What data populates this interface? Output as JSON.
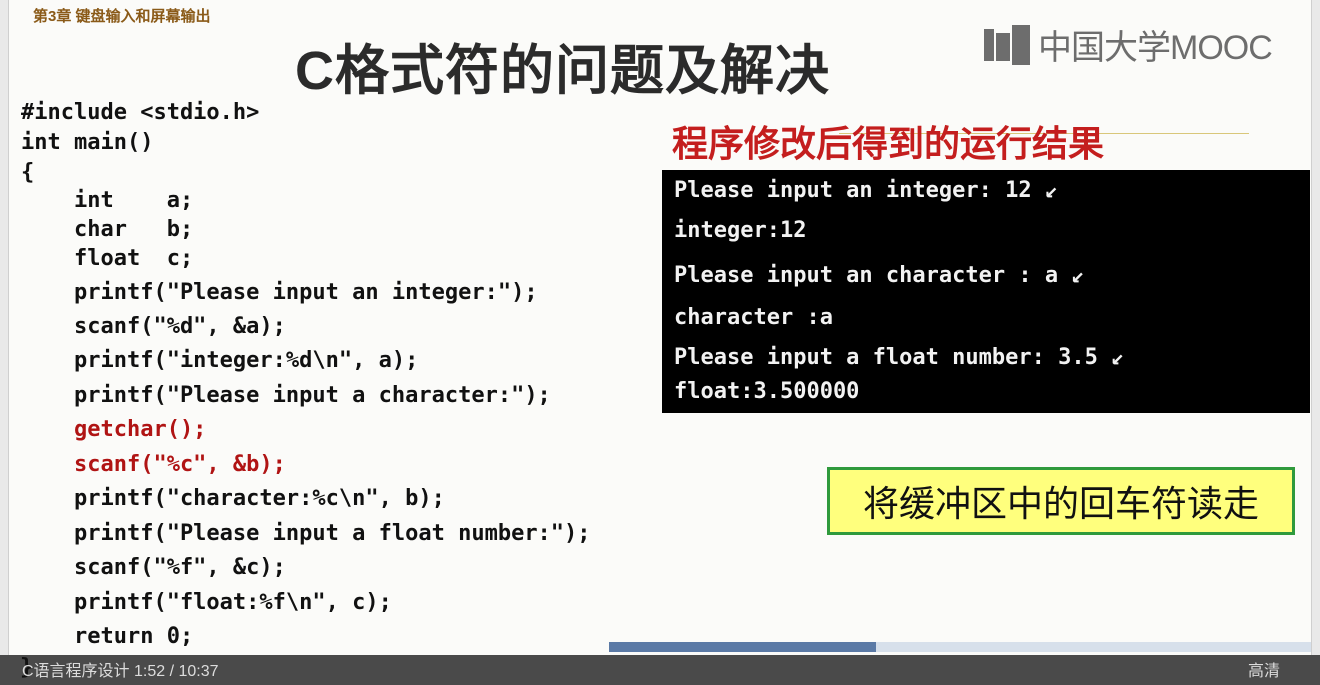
{
  "slide": {
    "chapter": "第3章 键盘输入和屏幕输出",
    "title": "C格式符的问题及解决",
    "logo_text": "中国大学MOOC",
    "code_lines": [
      "#include <stdio.h>",
      "int main()",
      "{",
      "    int    a;",
      "    char   b;",
      "    float  c;",
      "    printf(\"Please input an integer:\");",
      "    scanf(\"%d\", &a);",
      "    printf(\"integer:%d\\n\", a);",
      "    printf(\"Please input a character:\");",
      "    getchar();",
      "    scanf(\"%c\", &b);",
      "    printf(\"character:%c\\n\", b);",
      "    printf(\"Please input a float number:\");",
      "    scanf(\"%f\", &c);",
      "    printf(\"float:%f\\n\", c);",
      "    return 0;",
      "}"
    ],
    "result_title": "程序修改后得到的运行结果",
    "terminal_lines": [
      "Please input an integer: 12 ↙",
      "integer:12",
      "Please input an character : a ↙",
      "character :a",
      "Please input a float number: 3.5 ↙",
      "float:3.500000"
    ],
    "note": "将缓冲区中的回车符读走"
  },
  "player": {
    "progress": 0.38,
    "left_text": "C语言程序设计 1:52 / 10:37",
    "right_text": "高清"
  },
  "colors": {
    "accent_red": "#c41e1e",
    "note_bg": "#ffff7d",
    "note_border": "#2f9a3c"
  }
}
